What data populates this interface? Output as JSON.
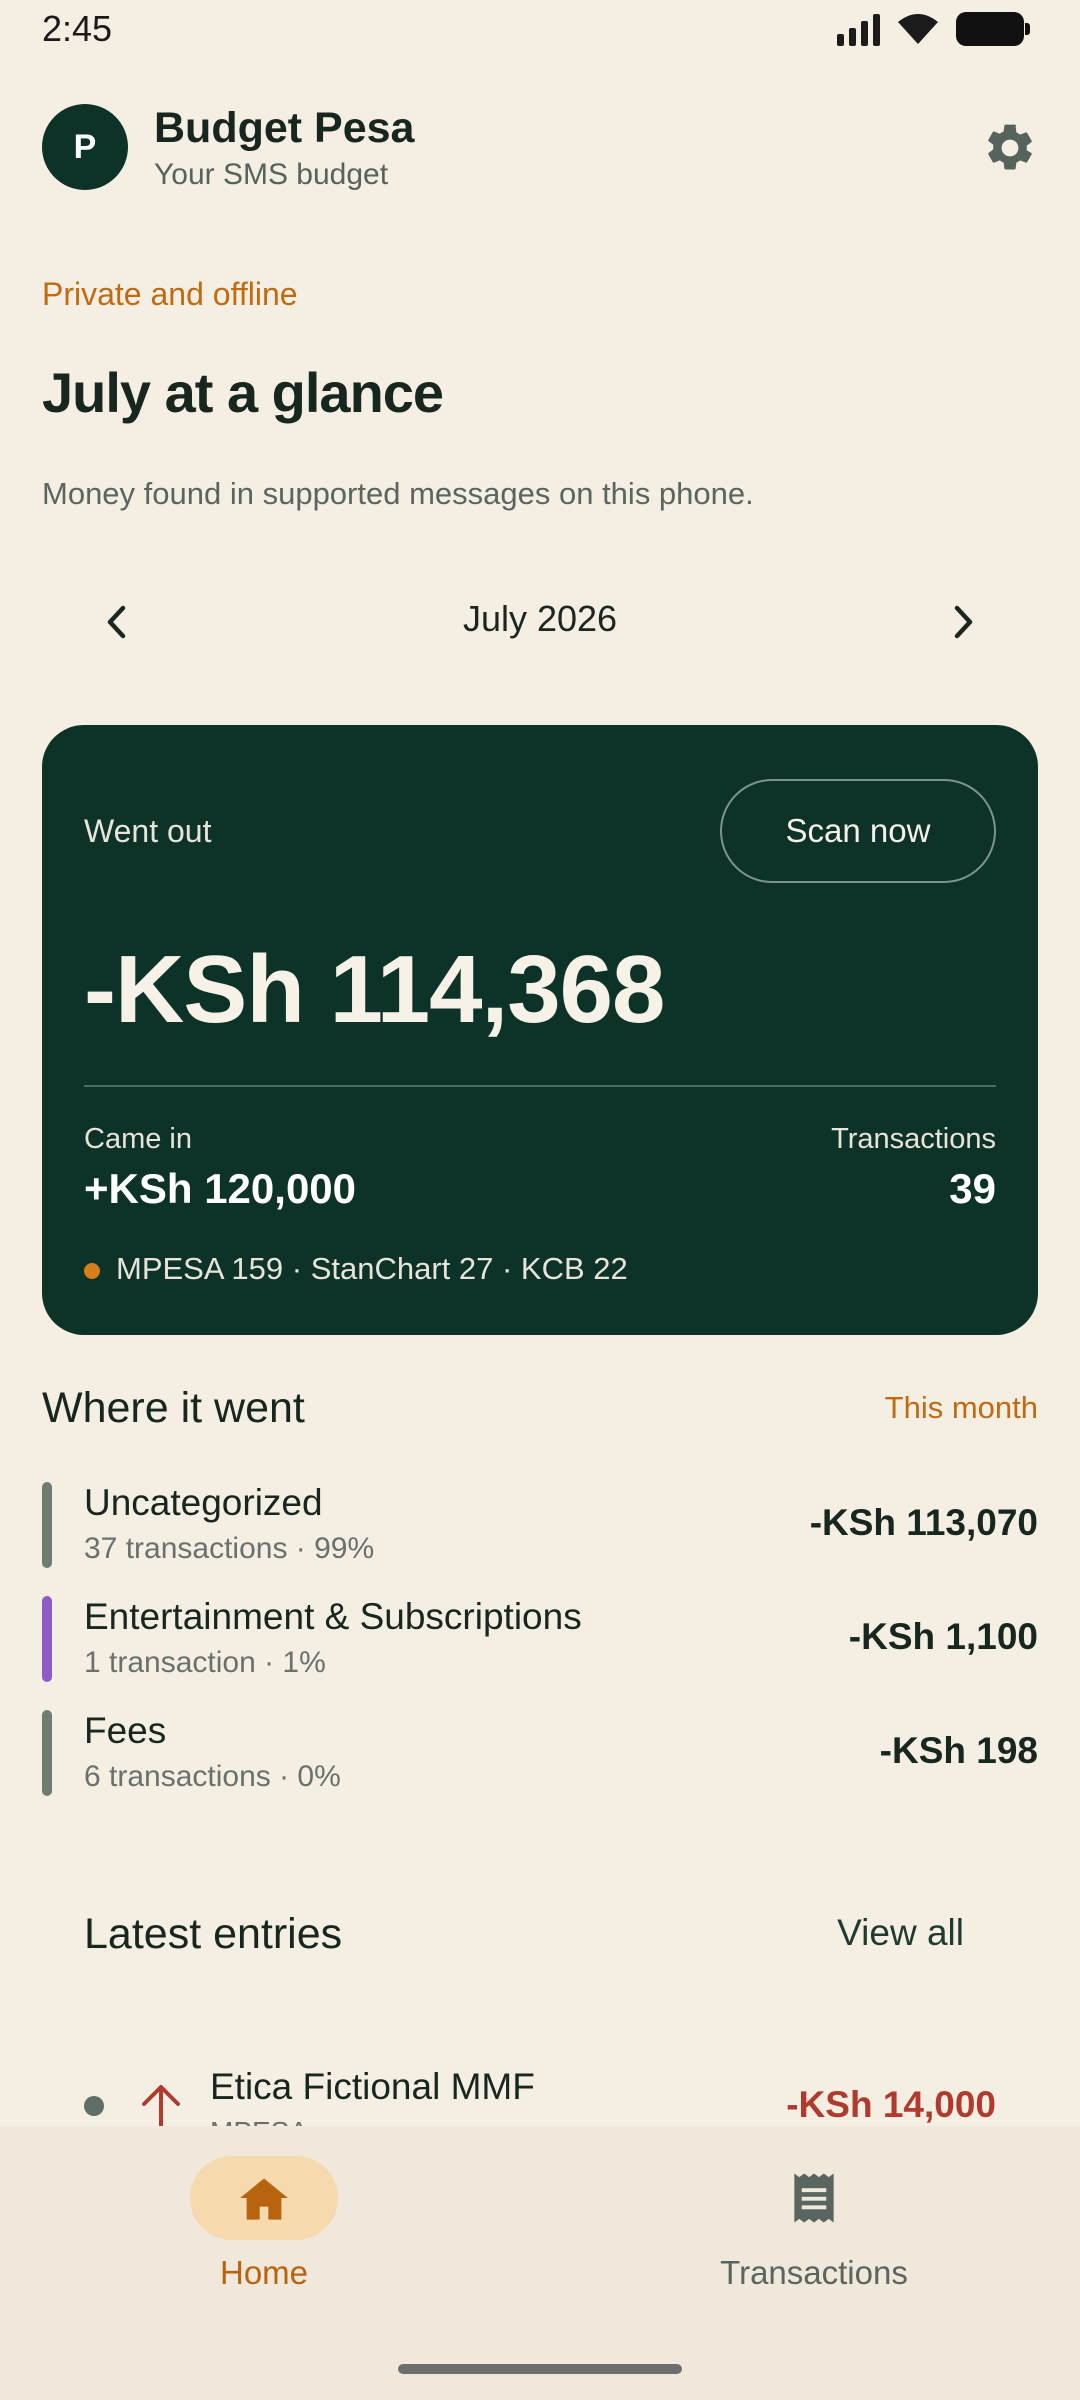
{
  "status_bar": {
    "time": "2:45"
  },
  "header": {
    "avatar_initial": "P",
    "title": "Budget Pesa",
    "subtitle": "Your SMS budget"
  },
  "eyebrow": "Private and offline",
  "page_title": "July at a glance",
  "description": "Money found in supported messages on this phone.",
  "month_switcher": {
    "label": "July 2026"
  },
  "summary": {
    "went_out_label": "Went out",
    "scan_button": "Scan now",
    "went_out_amount": "-KSh 114,368",
    "came_in_label": "Came in",
    "came_in_amount": "+KSh 120,000",
    "transactions_label": "Transactions",
    "transactions_count": "39",
    "sources": "MPESA 159 · StanChart 27 · KCB 22"
  },
  "where": {
    "title": "Where it went",
    "period": "This month",
    "categories": [
      {
        "name": "Uncategorized",
        "meta": "37 transactions · 99%",
        "amount": "-KSh 113,070",
        "color": "#6D7D74"
      },
      {
        "name": "Entertainment & Subscriptions",
        "meta": "1 transaction · 1%",
        "amount": "-KSh 1,100",
        "color": "#8F5BC4"
      },
      {
        "name": "Fees",
        "meta": "6 transactions · 0%",
        "amount": "-KSh 198",
        "color": "#6D7D74"
      }
    ]
  },
  "latest": {
    "title": "Latest entries",
    "view_all": "View all",
    "entries": [
      {
        "name": "Etica Fictional MMF",
        "source": "MPESA",
        "amount": "-KSh 14,000"
      }
    ]
  },
  "nav": {
    "home": "Home",
    "transactions": "Transactions"
  },
  "colors": {
    "background": "#F5EFE3",
    "card": "#0D3329",
    "accent": "#C06A12",
    "negative": "#B03A2E"
  }
}
